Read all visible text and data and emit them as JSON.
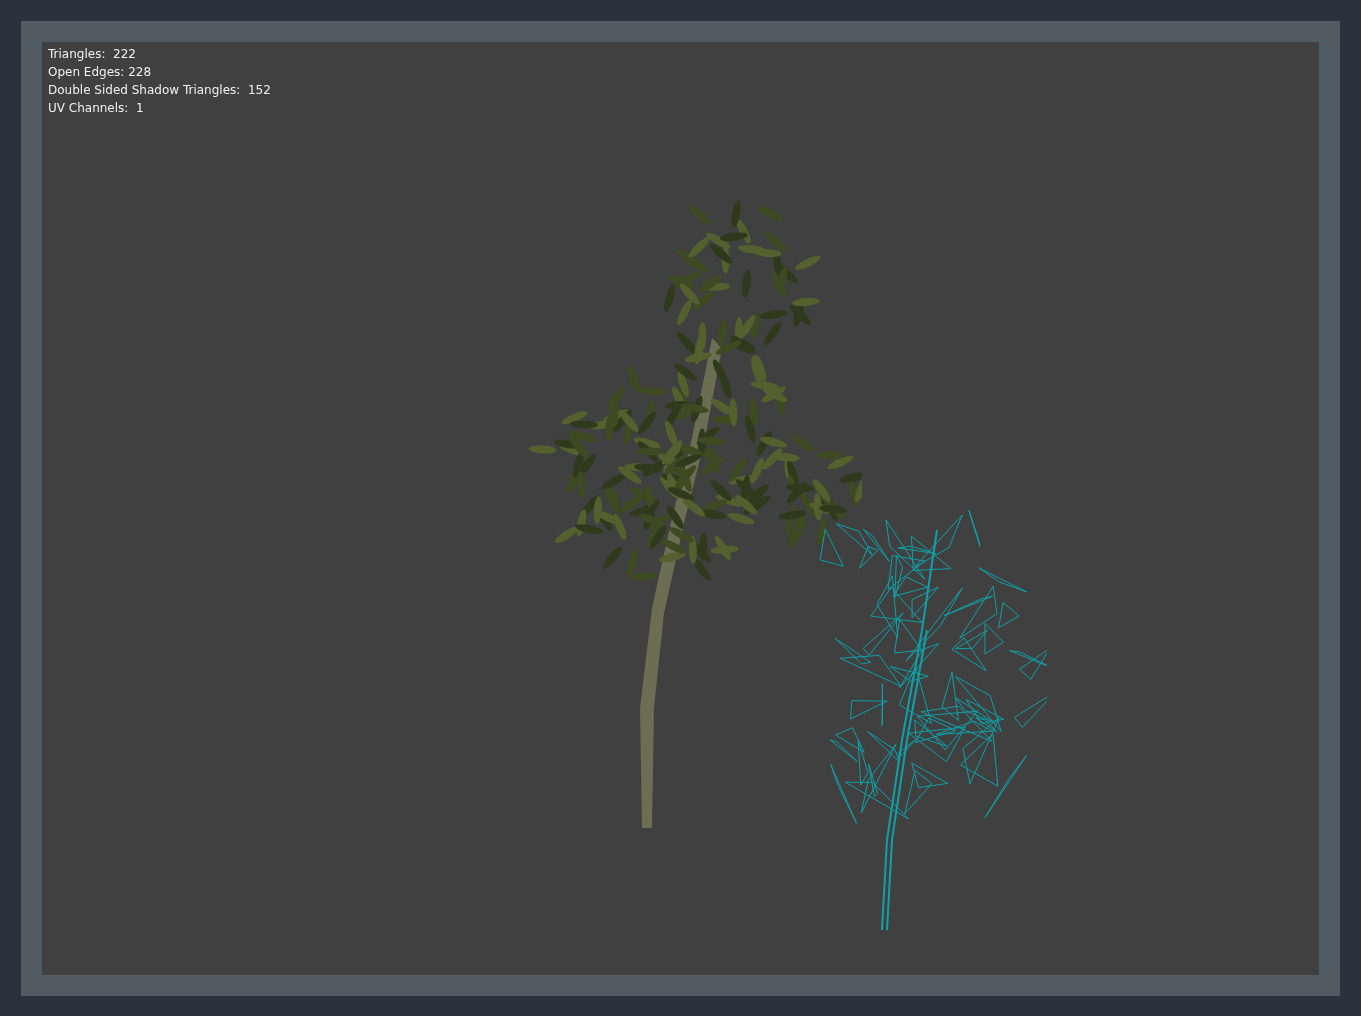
{
  "viewport": {
    "stats": [
      "Triangles:  222",
      "Open Edges: 228",
      "Double Sided Shadow Triangles:  152",
      "UV Channels:  1"
    ]
  }
}
